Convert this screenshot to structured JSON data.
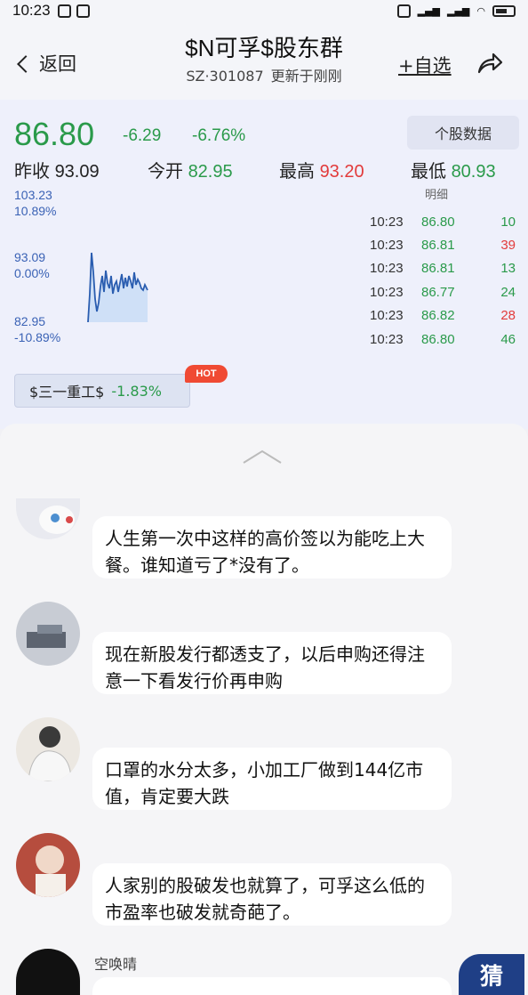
{
  "status": {
    "time": "10:23"
  },
  "header": {
    "back_label": "返回",
    "title": "$N可孚$股东群",
    "code": "SZ·301087",
    "updated": "更新于刚刚",
    "watch_label": "+自选"
  },
  "quote": {
    "price": "86.80",
    "change": "-6.29",
    "change_pct": "-6.76%",
    "stock_data_label": "个股数据",
    "prev_close_label": "昨收",
    "prev_close": "93.09",
    "open_label": "今开",
    "open": "82.95",
    "high_label": "最高",
    "high": "93.20",
    "low_label": "最低",
    "low": "80.93",
    "chart_labels": {
      "top_price": "103.23",
      "top_pct": "10.89%",
      "mid_price": "93.09",
      "mid_pct": "0.00%",
      "bot_price": "82.95",
      "bot_pct": "-10.89%"
    },
    "ticks_title": "明细",
    "ticks": [
      {
        "time": "10:23",
        "price": "86.80",
        "vol": "10",
        "color": "#2a9a4a"
      },
      {
        "time": "10:23",
        "price": "86.81",
        "vol": "39",
        "color": "#e23b3b"
      },
      {
        "time": "10:23",
        "price": "86.81",
        "vol": "13",
        "color": "#2a9a4a"
      },
      {
        "time": "10:23",
        "price": "86.77",
        "vol": "24",
        "color": "#2a9a4a"
      },
      {
        "time": "10:23",
        "price": "86.82",
        "vol": "28",
        "color": "#e23b3b"
      },
      {
        "time": "10:23",
        "price": "86.80",
        "vol": "46",
        "color": "#2a9a4a"
      }
    ],
    "related_name": "$三一重工$",
    "related_change": "-1.83%",
    "hot_badge": "HOT"
  },
  "comments": [
    {
      "name": "",
      "text": "人生第一次中这样的高价签以为能吃上大餐。谁知道亏了*没有了。"
    },
    {
      "name": "",
      "text": "现在新股发行都透支了，以后申购还得注意一下看发行价再申购"
    },
    {
      "name": "",
      "text": "口罩的水分太多，小加工厂做到144亿市值，肯定要大跌"
    },
    {
      "name": "",
      "text": "人家别的股破发也就算了，可孚这么低的市盈率也破发就奇葩了。"
    },
    {
      "name": "空唤晴",
      "text": ""
    }
  ],
  "fab_label": "猜"
}
